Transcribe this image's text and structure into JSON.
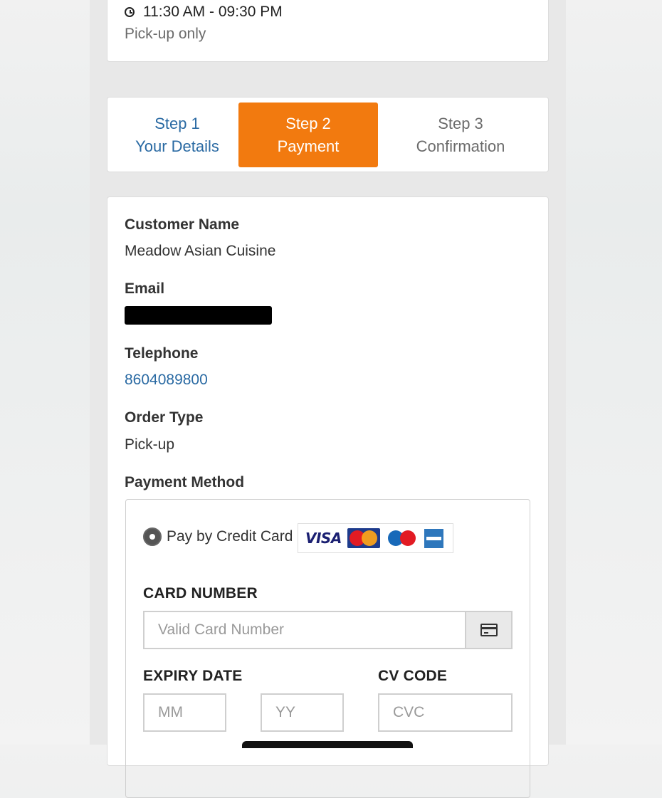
{
  "store": {
    "hours": "11:30 AM - 09:30 PM",
    "service_note": "Pick-up only"
  },
  "steps": [
    {
      "number": "Step 1",
      "title": "Your Details",
      "state": "completed"
    },
    {
      "number": "Step 2",
      "title": "Payment",
      "state": "active"
    },
    {
      "number": "Step 3",
      "title": "Confirmation",
      "state": "upcoming"
    }
  ],
  "details": {
    "customer_name_label": "Customer Name",
    "customer_name": "Meadow Asian Cuisine",
    "email_label": "Email",
    "telephone_label": "Telephone",
    "telephone": "8604089800",
    "order_type_label": "Order Type",
    "order_type": "Pick-up",
    "payment_method_label": "Payment Method"
  },
  "payment": {
    "option_label": "Pay by Credit Card",
    "accepted_cards": [
      "VISA",
      "MasterCard",
      "Maestro",
      "American Express"
    ],
    "card_number_label": "CARD NUMBER",
    "card_number_placeholder": "Valid Card Number",
    "expiry_label": "EXPIRY DATE",
    "month_placeholder": "MM",
    "year_placeholder": "YY",
    "cv_label": "CV CODE",
    "cvc_placeholder": "CVC"
  },
  "colors": {
    "accent": "#f27a0f",
    "link": "#2a6aa3",
    "muted_text": "#6b6b6b"
  }
}
